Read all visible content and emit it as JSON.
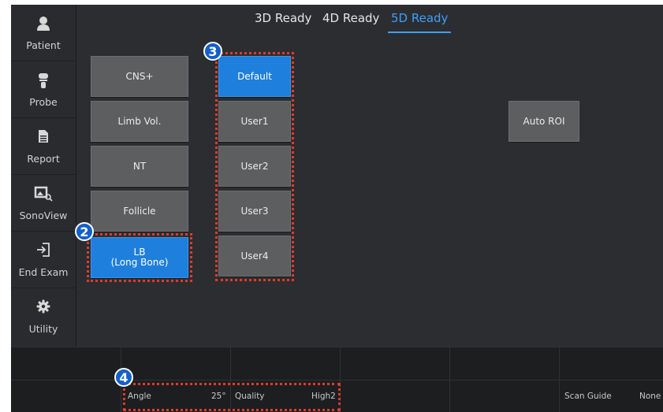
{
  "sidebar": {
    "items": [
      {
        "label": "Patient",
        "icon": "person-icon"
      },
      {
        "label": "Probe",
        "icon": "probe-icon"
      },
      {
        "label": "Report",
        "icon": "document-icon"
      },
      {
        "label": "SonoView",
        "icon": "sonoview-icon"
      },
      {
        "label": "End Exam",
        "icon": "exit-icon"
      },
      {
        "label": "Utility",
        "icon": "gear-icon"
      }
    ]
  },
  "tabs": [
    {
      "label": "3D Ready"
    },
    {
      "label": "4D Ready"
    },
    {
      "label": "5D Ready"
    }
  ],
  "active_tab": "5D Ready",
  "left_buttons": [
    {
      "label": "CNS+"
    },
    {
      "label": "Limb Vol."
    },
    {
      "label": "NT"
    },
    {
      "label": "Follicle"
    },
    {
      "label": "LB\n(Long Bone)"
    }
  ],
  "selected_left": "LB (Long Bone)",
  "presets": [
    {
      "label": "Default"
    },
    {
      "label": "User1"
    },
    {
      "label": "User2"
    },
    {
      "label": "User3"
    },
    {
      "label": "User4"
    }
  ],
  "selected_preset": "Default",
  "auto_roi_label": "Auto ROI",
  "callouts": {
    "c2": "2",
    "c3": "3",
    "c4": "4"
  },
  "bottom_params": {
    "angle_label": "Angle",
    "angle_value": "25°",
    "quality_label": "Quality",
    "quality_value": "High2",
    "scan_guide_label": "Scan Guide",
    "scan_guide_value": "None"
  },
  "colors": {
    "accent": "#1f7fdc",
    "tab_active": "#3ba0ff",
    "annotation": "#e03a2c",
    "callout": "#1560c8"
  }
}
